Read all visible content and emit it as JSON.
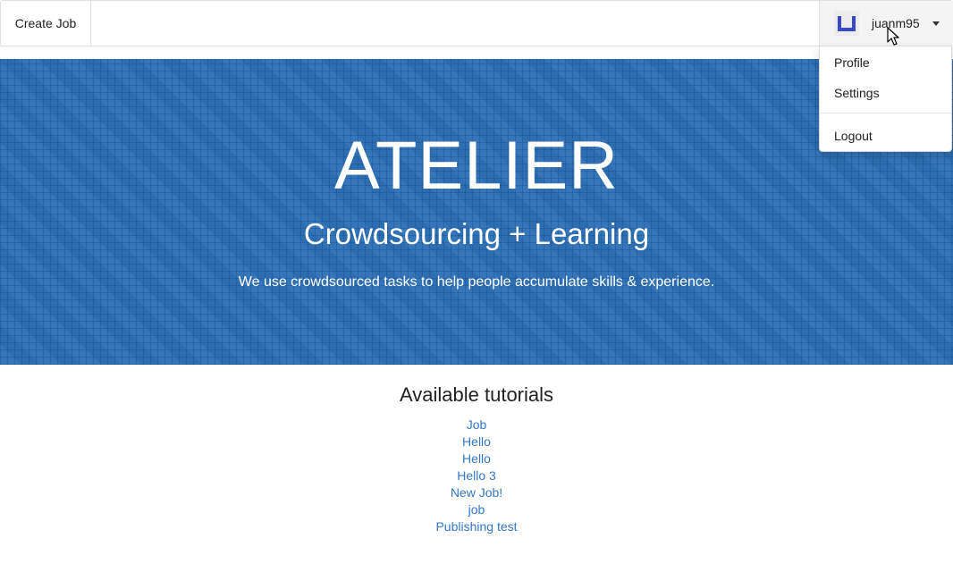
{
  "navbar": {
    "create_job_label": "Create Job",
    "username": "juanm95",
    "avatar_colors": {
      "background": "#ececec",
      "glyph": "#3b47c9"
    }
  },
  "user_menu": {
    "items": [
      {
        "label": "Profile"
      },
      {
        "label": "Settings"
      }
    ],
    "logout_label": "Logout"
  },
  "hero": {
    "title": "ATELIER",
    "subtitle": "Crowdsourcing + Learning",
    "description": "We use crowdsourced tasks to help people accumulate skills & experience.",
    "background_color": "#2e72b6"
  },
  "tutorials": {
    "heading": "Available tutorials",
    "link_color": "#3478c6",
    "items": [
      {
        "label": "Job"
      },
      {
        "label": "Hello"
      },
      {
        "label": "Hello"
      },
      {
        "label": "Hello 3"
      },
      {
        "label": "New Job!"
      },
      {
        "label": "job"
      },
      {
        "label": "Publishing test"
      }
    ]
  },
  "icons": {
    "avatar": "avatar-icon",
    "caret": "caret-down-icon",
    "cursor": "mouse-pointer-icon"
  }
}
